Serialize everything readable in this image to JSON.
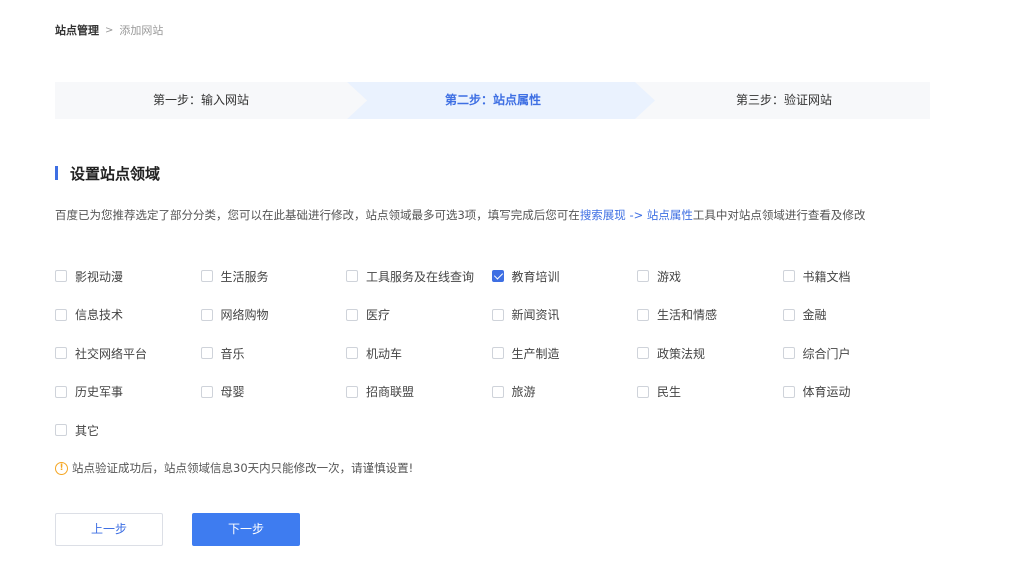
{
  "breadcrumb": {
    "parent": "站点管理",
    "separator": ">",
    "current": "添加网站"
  },
  "steps": [
    {
      "label": "第一步：输入网站",
      "active": false
    },
    {
      "label": "第二步：站点属性",
      "active": true
    },
    {
      "label": "第三步：验证网站",
      "active": false
    }
  ],
  "section": {
    "title": "设置站点领域"
  },
  "description": {
    "prefix": "百度已为您推荐选定了部分分类，您可以在此基础进行修改，站点领域最多可选3项，填写完成后您可在",
    "link": "搜索展现 -> 站点属性",
    "suffix": "工具中对站点领域进行查看及修改"
  },
  "categories": [
    {
      "label": "影视动漫",
      "checked": false
    },
    {
      "label": "生活服务",
      "checked": false
    },
    {
      "label": "工具服务及在线查询",
      "checked": false
    },
    {
      "label": "教育培训",
      "checked": true
    },
    {
      "label": "游戏",
      "checked": false
    },
    {
      "label": "书籍文档",
      "checked": false
    },
    {
      "label": "信息技术",
      "checked": false
    },
    {
      "label": "网络购物",
      "checked": false
    },
    {
      "label": "医疗",
      "checked": false
    },
    {
      "label": "新闻资讯",
      "checked": false
    },
    {
      "label": "生活和情感",
      "checked": false
    },
    {
      "label": "金融",
      "checked": false
    },
    {
      "label": "社交网络平台",
      "checked": false
    },
    {
      "label": "音乐",
      "checked": false
    },
    {
      "label": "机动车",
      "checked": false
    },
    {
      "label": "生产制造",
      "checked": false
    },
    {
      "label": "政策法规",
      "checked": false
    },
    {
      "label": "综合门户",
      "checked": false
    },
    {
      "label": "历史军事",
      "checked": false
    },
    {
      "label": "母婴",
      "checked": false
    },
    {
      "label": "招商联盟",
      "checked": false
    },
    {
      "label": "旅游",
      "checked": false
    },
    {
      "label": "民生",
      "checked": false
    },
    {
      "label": "体育运动",
      "checked": false
    },
    {
      "label": "其它",
      "checked": false
    }
  ],
  "notice": {
    "icon": "warning-icon",
    "text": "站点验证成功后，站点领域信息30天内只能修改一次，请谨慎设置!"
  },
  "buttons": {
    "prev": "上一步",
    "next": "下一步"
  },
  "colors": {
    "accent": "#3e6fe3",
    "primary_button": "#3e7cf0",
    "warning": "#f5a623",
    "step_bg": "#f7f8fa",
    "step_active_bg": "#eaf2fe"
  }
}
